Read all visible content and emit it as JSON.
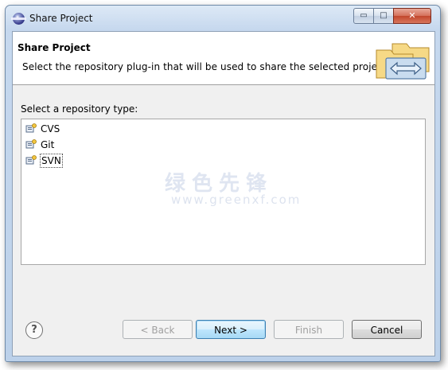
{
  "window": {
    "title": "Share Project",
    "controls": {
      "minimize": "▭",
      "maximize": "□",
      "close": "✕"
    }
  },
  "header": {
    "title": "Share Project",
    "description": "Select the repository plug-in that will be used to share the selected project.",
    "icon": "share-project-wizard-icon"
  },
  "repository": {
    "label": "Select a repository type:",
    "items": [
      {
        "label": "CVS",
        "icon": "repository-connector-icon"
      },
      {
        "label": "Git",
        "icon": "repository-connector-icon"
      },
      {
        "label": "SVN",
        "icon": "repository-connector-icon",
        "selected": true
      }
    ]
  },
  "watermark": {
    "text": "绿色先锋",
    "url": "www.greenxf.com"
  },
  "buttons": {
    "help": "?",
    "back": "< Back",
    "next": "Next >",
    "finish": "Finish",
    "cancel": "Cancel"
  },
  "colors": {
    "window_frame": "#bcd1ea",
    "dialog_bg": "#f0f0f0",
    "default_button_border": "#3c7fb1"
  }
}
